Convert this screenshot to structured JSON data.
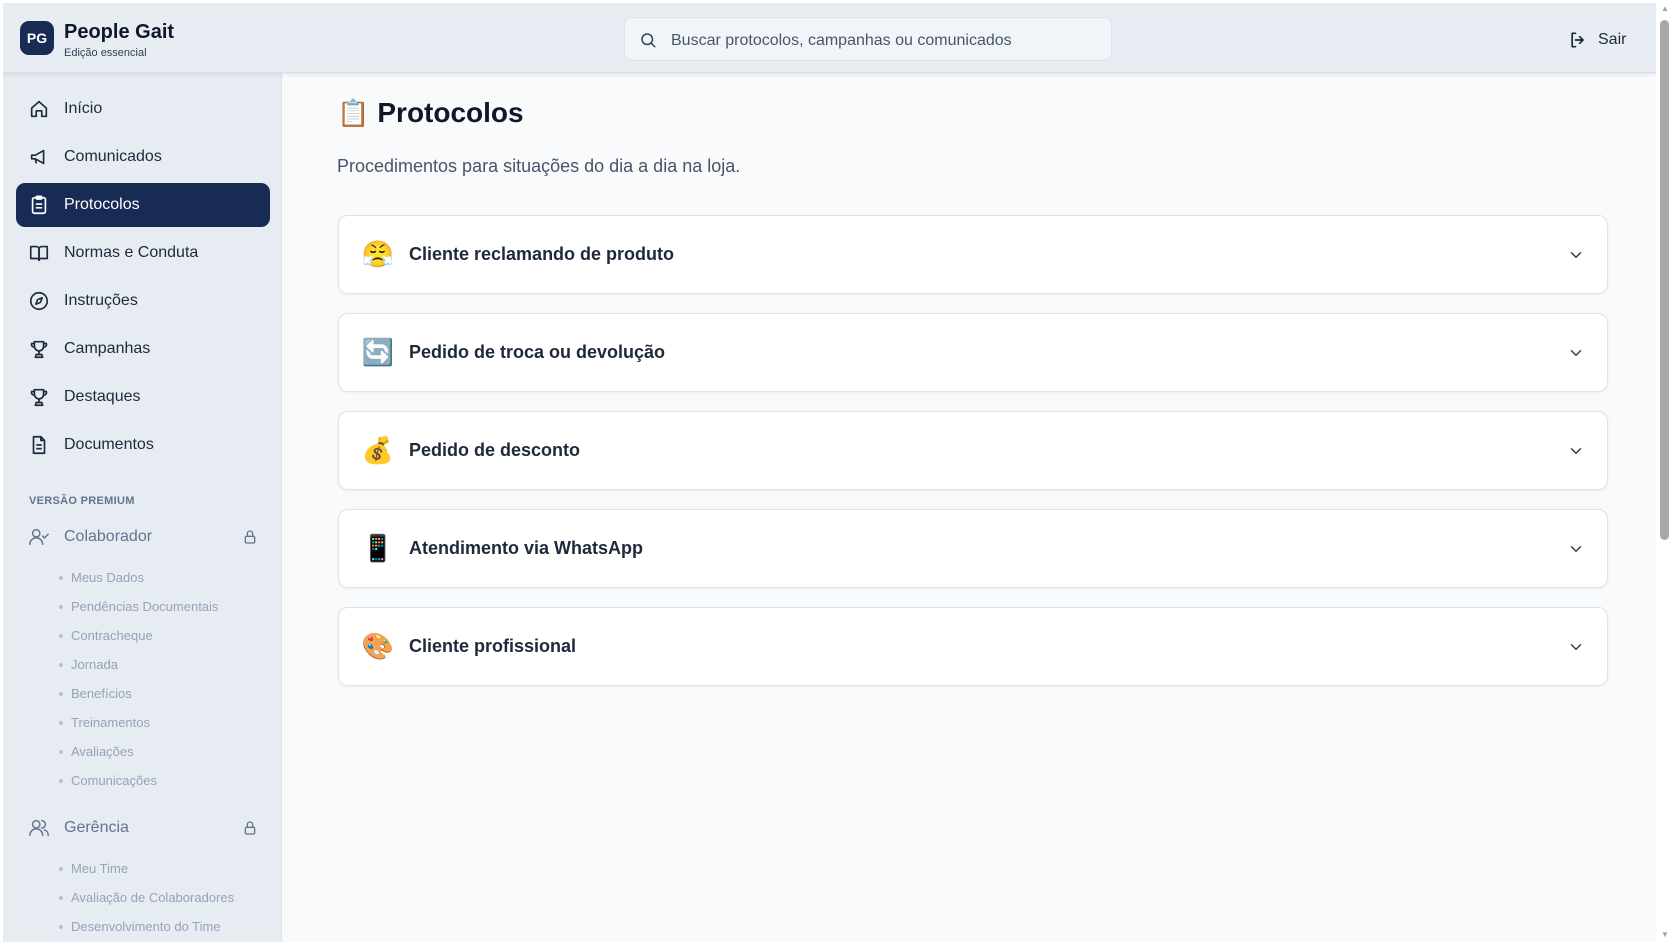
{
  "header": {
    "logo_initials": "PG",
    "app_name": "People Gait",
    "edition": "Edição essencial",
    "search_placeholder": "Buscar protocolos, campanhas ou comunicados",
    "logout_label": "Sair"
  },
  "sidebar": {
    "items": [
      {
        "label": "Início",
        "icon": "home-icon",
        "active": false
      },
      {
        "label": "Comunicados",
        "icon": "megaphone-icon",
        "active": false
      },
      {
        "label": "Protocolos",
        "icon": "clipboard-icon",
        "active": true
      },
      {
        "label": "Normas e Conduta",
        "icon": "book-icon",
        "active": false
      },
      {
        "label": "Instruções",
        "icon": "compass-icon",
        "active": false
      },
      {
        "label": "Campanhas",
        "icon": "trophy-icon",
        "active": false
      },
      {
        "label": "Destaques",
        "icon": "trophy-icon",
        "active": false
      },
      {
        "label": "Documentos",
        "icon": "document-icon",
        "active": false
      }
    ],
    "premium_label": "VERSÃO PREMIUM",
    "premium_groups": [
      {
        "label": "Colaborador",
        "icon": "user-check-icon",
        "locked": true,
        "items": [
          "Meus Dados",
          "Pendências Documentais",
          "Contracheque",
          "Jornada",
          "Benefícios",
          "Treinamentos",
          "Avaliações",
          "Comunicações"
        ]
      },
      {
        "label": "Gerência",
        "icon": "users-icon",
        "locked": true,
        "items": [
          "Meu Time",
          "Avaliação de Colaboradores",
          "Desenvolvimento do Time"
        ]
      }
    ]
  },
  "main": {
    "title_icon": "📋",
    "title": "Protocolos",
    "description": "Procedimentos para situações do dia a dia na loja.",
    "protocols": [
      {
        "emoji": "😤",
        "title": "Cliente reclamando de produto"
      },
      {
        "emoji": "🔄",
        "title": "Pedido de troca ou devolução"
      },
      {
        "emoji": "💰",
        "title": "Pedido de desconto"
      },
      {
        "emoji": "📱",
        "title": "Atendimento via WhatsApp"
      },
      {
        "emoji": "🎨",
        "title": "Cliente profissional"
      }
    ]
  },
  "colors": {
    "primary": "#172b54",
    "sidebar_bg": "#e7ecf3",
    "page_bg": "#f8fafc"
  }
}
